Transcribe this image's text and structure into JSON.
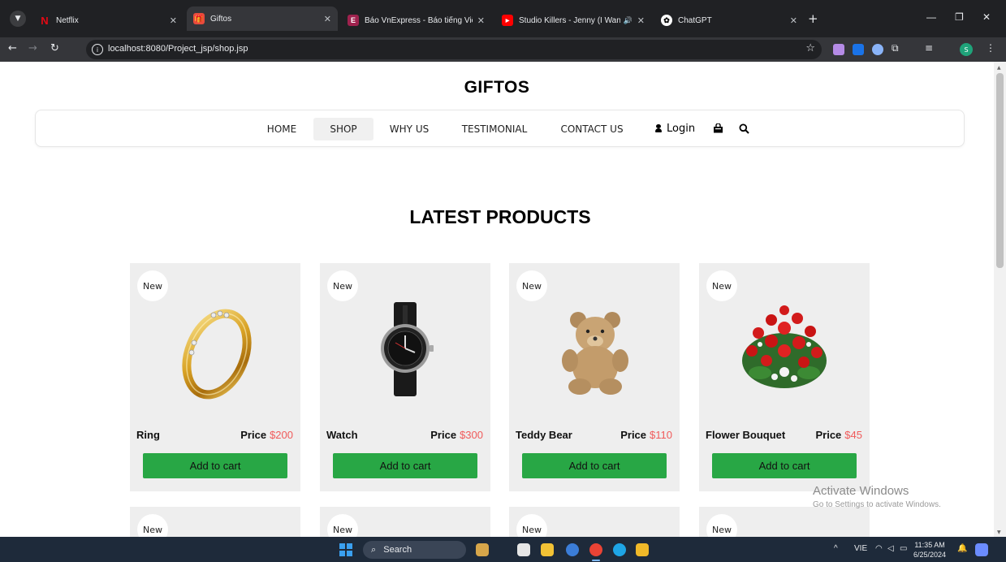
{
  "browser": {
    "tabs": [
      {
        "title": "Netflix",
        "icon": "netflix-icon",
        "active": false
      },
      {
        "title": "Giftos",
        "icon": "gift-icon",
        "active": true
      },
      {
        "title": "Báo VnExpress - Báo tiếng Việt",
        "icon": "vnexpress-icon",
        "active": false
      },
      {
        "title": "Studio Killers - Jenny (I Wan",
        "icon": "youtube-icon",
        "active": false
      },
      {
        "title": "ChatGPT",
        "icon": "chatgpt-icon",
        "active": false
      }
    ],
    "url": "localhost:8080/Project_jsp/shop.jsp"
  },
  "site": {
    "brand": "GIFTOS",
    "nav": [
      {
        "label": "HOME",
        "active": false
      },
      {
        "label": "SHOP",
        "active": true
      },
      {
        "label": "WHY US",
        "active": false
      },
      {
        "label": "TESTIMONIAL",
        "active": false
      },
      {
        "label": "CONTACT US",
        "active": false
      }
    ],
    "login_label": "Login"
  },
  "section_title": "LATEST PRODUCTS",
  "products": [
    {
      "badge": "New",
      "name": "Ring",
      "price_label": "Price",
      "price": "$200",
      "button": "Add to cart",
      "image": "ring-image"
    },
    {
      "badge": "New",
      "name": "Watch",
      "price_label": "Price",
      "price": "$300",
      "button": "Add to cart",
      "image": "watch-image"
    },
    {
      "badge": "New",
      "name": "Teddy Bear",
      "price_label": "Price",
      "price": "$110",
      "button": "Add to cart",
      "image": "teddy-bear-image"
    },
    {
      "badge": "New",
      "name": "Flower Bouquet",
      "price_label": "Price",
      "price": "$45",
      "button": "Add to cart",
      "image": "flower-bouquet-image"
    }
  ],
  "next_row_badges": [
    "New",
    "New",
    "New",
    "New"
  ],
  "watermark": {
    "line1": "Activate Windows",
    "line2": "Go to Settings to activate Windows."
  },
  "taskbar": {
    "search_label": "Search",
    "language": "VIE",
    "time": "11:35 AM",
    "date": "6/25/2024"
  },
  "colors": {
    "accent_green": "#28a745",
    "price_red": "#f05a5a",
    "card_bg": "#eeeeee"
  }
}
